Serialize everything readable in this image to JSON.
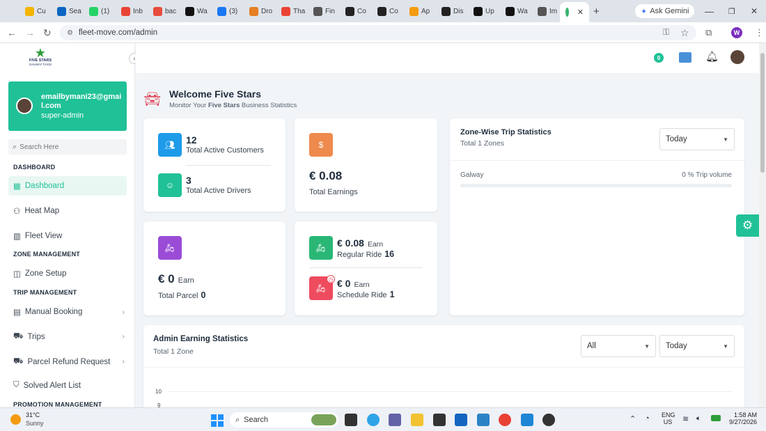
{
  "browser": {
    "tabs": [
      {
        "label": "Cu",
        "color": "#f4b400"
      },
      {
        "label": "Sea",
        "color": "#0a66c2"
      },
      {
        "label": "(1)",
        "color": "#25d366"
      },
      {
        "label": "Inb",
        "color": "#ea4335"
      },
      {
        "label": "bac",
        "color": "#e74c3c"
      },
      {
        "label": "Wa",
        "color": "#111"
      },
      {
        "label": "(3)",
        "color": "#1877f2"
      },
      {
        "label": "Dro",
        "color": "#e67e22"
      },
      {
        "label": "Tha",
        "color": "#ea4335"
      },
      {
        "label": "Fin",
        "color": "#555"
      },
      {
        "label": "Co",
        "color": "#222"
      },
      {
        "label": "Co",
        "color": "#222"
      },
      {
        "label": "Ap",
        "color": "#f39c12"
      },
      {
        "label": "Dis",
        "color": "#222"
      },
      {
        "label": "Up",
        "color": "#111"
      },
      {
        "label": "Wa",
        "color": "#111"
      },
      {
        "label": "Im",
        "color": "#555"
      }
    ],
    "gemini_label": "Ask Gemini",
    "url": "fleet-move.com/admin",
    "profile_initial": "W"
  },
  "sidebar": {
    "logo_line1": "FIVE STARS",
    "logo_line2": "GALWAY TAXIS",
    "user_email": "emailbymani23@gmail.com",
    "user_role": "super-admin",
    "search_placeholder": "Search Here",
    "sections": {
      "dashboard": "DASHBOARD",
      "zone": "ZONE MANAGEMENT",
      "trip": "TRIP MANAGEMENT",
      "promotion": "PROMOTION MANAGEMENT"
    },
    "items": {
      "dashboard": "Dashboard",
      "heat_map": "Heat Map",
      "fleet_view": "Fleet View",
      "zone_setup": "Zone Setup",
      "manual_booking": "Manual Booking",
      "trips": "Trips",
      "parcel_refund": "Parcel Refund Request",
      "solved_alert": "Solved Alert List"
    }
  },
  "header": {
    "badge_count": "0"
  },
  "welcome": {
    "title": "Welcome Five Stars",
    "sub_prefix": "Monitor Your ",
    "sub_bold": "Five Stars",
    "sub_suffix": " Business Statistics"
  },
  "stats": {
    "customers_value": "12",
    "customers_label": "Total Active Customers",
    "drivers_value": "3",
    "drivers_label": "Total Active Drivers",
    "earnings_value": "€ 0.08",
    "earnings_label": "Total Earnings",
    "parcel_value": "€ 0",
    "parcel_earn": "Earn",
    "parcel_label": "Total Parcel",
    "parcel_count": "0",
    "regular_value": "€ 0.08",
    "regular_earn": "Earn",
    "regular_label": "Regular Ride",
    "regular_count": "16",
    "schedule_value": "€ 0",
    "schedule_earn": "Earn",
    "schedule_label": "Schedule Ride",
    "schedule_count": "1"
  },
  "zone_stats": {
    "title": "Zone-Wise Trip Statistics",
    "subtitle": "Total 1 Zones",
    "filter": "Today",
    "zone_name": "Galway",
    "zone_volume": "0 % Trip volume",
    "zone_progress": 0
  },
  "admin_earning": {
    "title": "Admin Earning Statistics",
    "subtitle": "Total 1 Zone",
    "filter_zone": "All",
    "filter_time": "Today",
    "y_ticks": [
      "10",
      "9"
    ]
  },
  "taskbar": {
    "weather_temp": "31°C",
    "weather_desc": "Sunny",
    "search": "Search",
    "lang1": "ENG",
    "lang2": "US",
    "time": "1:58 AM",
    "date": "9/27/2026"
  },
  "colors": {
    "teal": "#20c197",
    "blue": "#1e9be9",
    "orange": "#ee8a4d",
    "purple": "#9b4cd6",
    "green": "#2ab776",
    "red": "#ee4b5e"
  }
}
